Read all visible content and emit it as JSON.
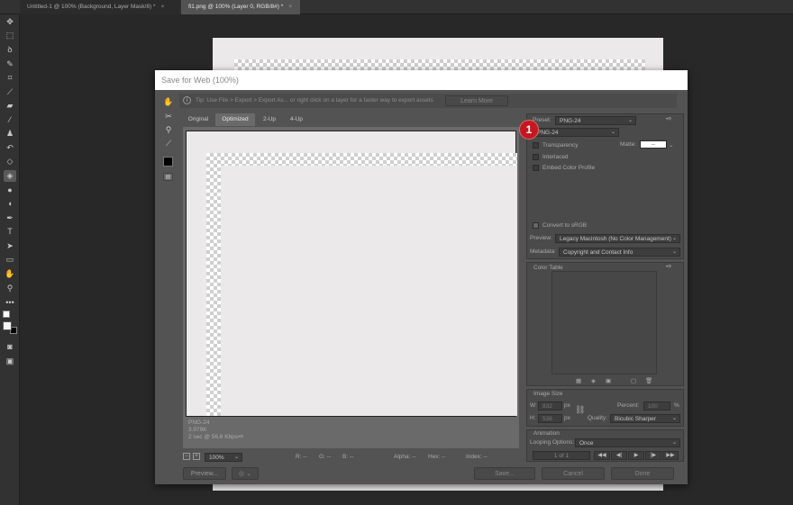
{
  "tabs": [
    {
      "label": "Untitled-1 @ 100% (Background, Layer Mask/8) *",
      "close": "×",
      "active": false
    },
    {
      "label": "fi1.png @ 100% (Layer 0, RGB/8#) *",
      "close": "×",
      "active": true
    }
  ],
  "tools": [
    "move-icon",
    "marquee-icon",
    "lasso-icon",
    "quick-select-icon",
    "crop-icon",
    "eyedropper-icon",
    "healing-icon",
    "brush-icon",
    "stamp-icon",
    "history-brush-icon",
    "eraser-icon",
    "paint-bucket-icon",
    "blur-icon",
    "dodge-icon",
    "pen-icon",
    "type-icon",
    "path-select-icon",
    "rectangle-icon",
    "hand-icon",
    "zoom-icon",
    "more-tools-icon"
  ],
  "dialog": {
    "title": "Save for Web (100%)",
    "tip": "Tip: Use File > Export > Export As...  or right click on a layer for a faster way to export assets",
    "learn_more": "Learn More",
    "view_tabs": [
      "Original",
      "Optimized",
      "2-Up",
      "4-Up"
    ],
    "active_tab": "Optimized",
    "preview_info": {
      "format": "PNG-24",
      "size": "3.979K",
      "time": "2 sec @ 56.6 Kbps",
      "menu": "•≡"
    },
    "bottom_bar": {
      "zoom": "100%",
      "r": "R: --",
      "g": "G: --",
      "b": "B: --",
      "alpha": "Alpha: --",
      "hex": "Hex: --",
      "index": "Index: --"
    },
    "buttons": {
      "preview": "Preview...",
      "save": "Save...",
      "cancel": "Cancel",
      "done": "Done"
    },
    "settings": {
      "preset_label": "Preset:",
      "preset_value": "PNG-24",
      "format_value": "PNG-24",
      "transparency": "Transparency",
      "matte_label": "Matte:",
      "matte_value": "--",
      "interlaced": "Interlaced",
      "embed_profile": "Embed Color Profile",
      "convert_srgb": "Convert to sRGB",
      "preview_label": "Preview:",
      "preview_value": "Legacy Macintosh (No Color Management)",
      "metadata_label": "Metadata:",
      "metadata_value": "Copyright and Contact Info"
    },
    "color_table": {
      "title": "Color Table"
    },
    "image_size": {
      "title": "Image Size",
      "w_label": "W:",
      "w_value": "832",
      "w_unit": "px",
      "h_label": "H:",
      "h_value": "536",
      "h_unit": "px",
      "percent_label": "Percent:",
      "percent_value": "100",
      "percent_unit": "%",
      "quality_label": "Quality:",
      "quality_value": "Bicubic Sharper"
    },
    "animation": {
      "title": "Animation",
      "looping_label": "Looping Options:",
      "looping_value": "Once",
      "frame_counter": "1 of 1"
    }
  },
  "badge": "1",
  "colors": {
    "accent_badge": "#c4171f",
    "dialog_bg": "#535353",
    "app_bg": "#282828"
  }
}
